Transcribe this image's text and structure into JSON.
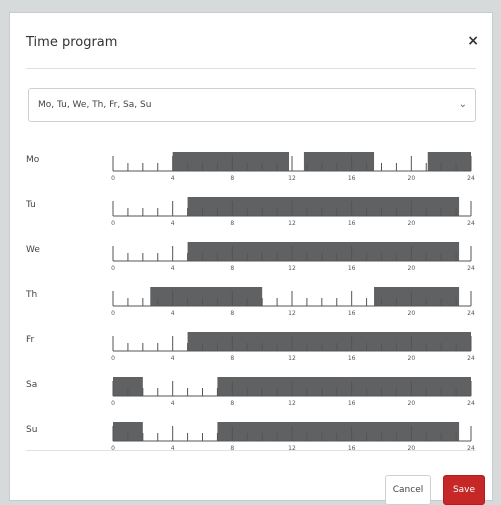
{
  "dialog": {
    "title": "Time program",
    "close_icon": "close-icon"
  },
  "days_select": {
    "value": "Mo, Tu, We, Th, Fr, Sa, Su",
    "icon": "chevron-down-icon"
  },
  "schedule": {
    "tick_labels": [
      "0",
      "4",
      "8",
      "12",
      "16",
      "20",
      "24"
    ],
    "days": [
      {
        "label": "Mo",
        "blocks": [
          [
            4,
            11.8
          ],
          [
            12.8,
            17.5
          ],
          [
            21.1,
            24
          ]
        ]
      },
      {
        "label": "Tu",
        "blocks": [
          [
            5,
            23.2
          ]
        ]
      },
      {
        "label": "We",
        "blocks": [
          [
            5,
            23.2
          ]
        ]
      },
      {
        "label": "Th",
        "blocks": [
          [
            2.5,
            10
          ],
          [
            17.5,
            23.2
          ]
        ]
      },
      {
        "label": "Fr",
        "blocks": [
          [
            5,
            24
          ]
        ]
      },
      {
        "label": "Sa",
        "blocks": [
          [
            0,
            2
          ],
          [
            7,
            24
          ]
        ]
      },
      {
        "label": "Su",
        "blocks": [
          [
            0,
            2
          ],
          [
            7,
            23.2
          ]
        ]
      }
    ]
  },
  "buttons": {
    "cancel": "Cancel",
    "save": "Save"
  },
  "colors": {
    "block": "#5f6163",
    "accent": "#c62828"
  }
}
